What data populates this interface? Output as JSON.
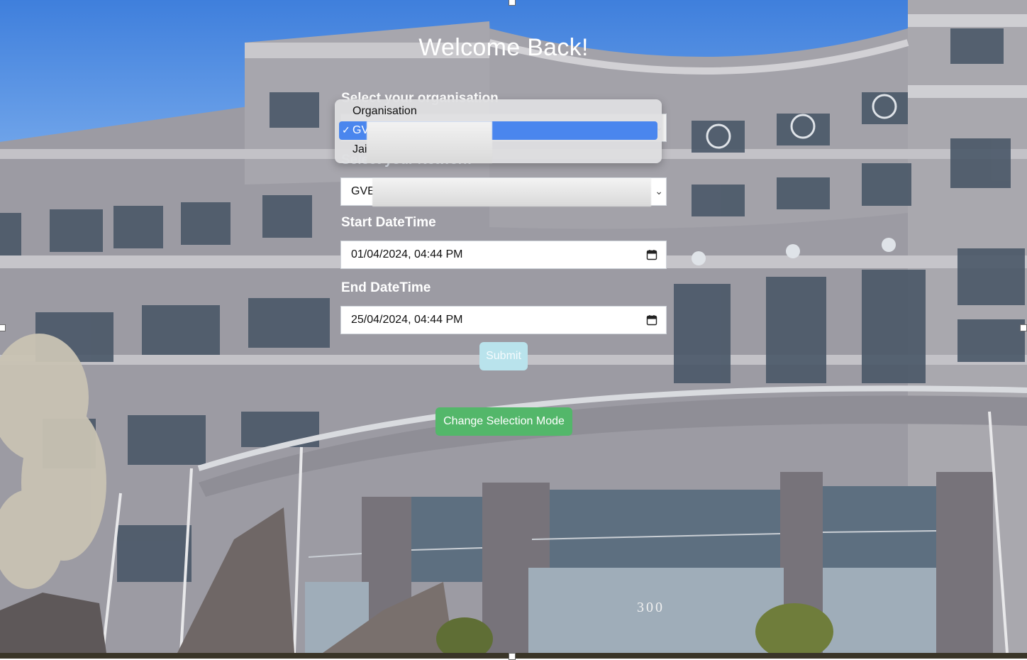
{
  "title": "Welcome Back!",
  "organisation": {
    "label": "Select your organisation",
    "options": [
      {
        "label": "Organisation",
        "selected": false
      },
      {
        "label": "GV",
        "selected": true
      },
      {
        "label": "Jai",
        "selected": false
      }
    ],
    "checkmark": "✓"
  },
  "network": {
    "label": "Select your Network",
    "value": "GVE"
  },
  "start": {
    "label": "Start DateTime",
    "value": "01/04/2024, 04:44 PM"
  },
  "end": {
    "label": "End DateTime",
    "value": "25/04/2024, 04:44 PM"
  },
  "buttons": {
    "submit": "Submit",
    "change_mode": "Change Selection Mode"
  },
  "building_sign": "300",
  "colors": {
    "selected_option": "#4a86ee",
    "submit_button": "#b9e3ec",
    "mode_button": "#53b76a"
  },
  "icons": {
    "select_chevron": "chevron-down-icon",
    "calendar": "calendar-icon"
  }
}
